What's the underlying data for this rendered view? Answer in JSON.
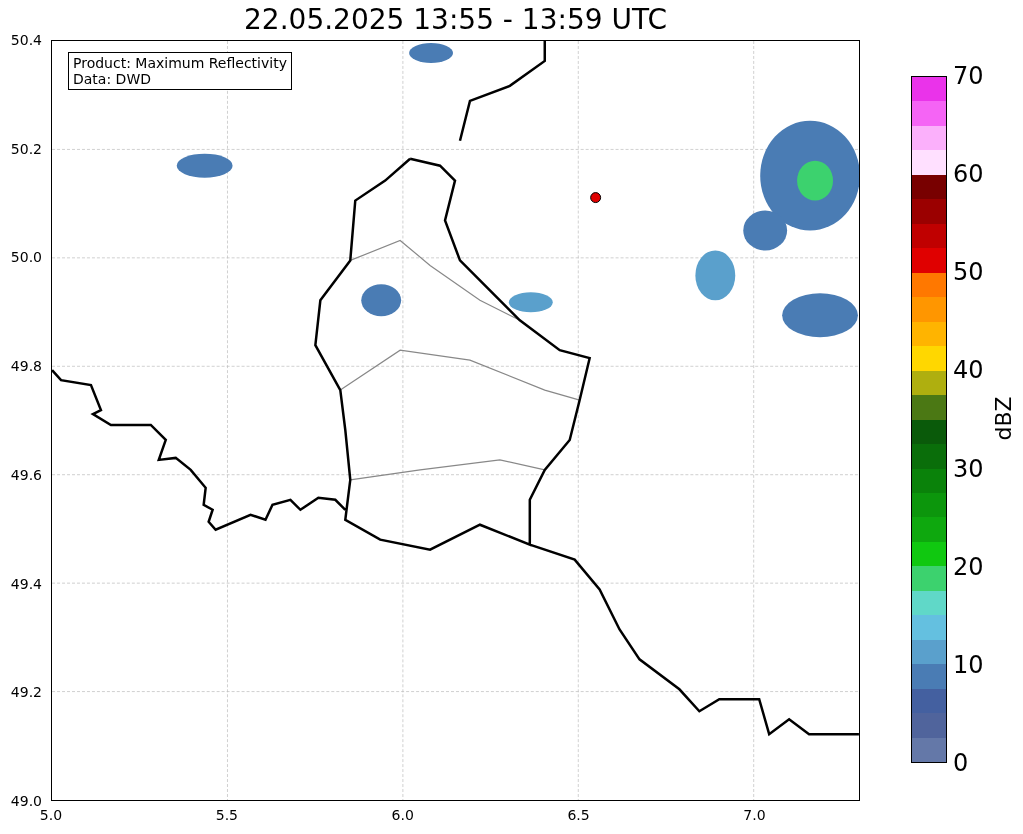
{
  "title": "22.05.2025 13:55 - 13:59 UTC",
  "map": {
    "legend": [
      "Product: Maximum Reflectivity",
      "Data: DWD"
    ],
    "x_ticks": [
      "5.0",
      "5.5",
      "6.0",
      "6.5",
      "7.0"
    ],
    "y_ticks": [
      "50.4",
      "50.2",
      "50.0",
      "49.8",
      "49.6",
      "49.4",
      "49.2",
      "49.0"
    ]
  },
  "colorbar": {
    "label": "dBZ",
    "ticks": [
      "70",
      "60",
      "50",
      "40",
      "30",
      "20",
      "10",
      "0"
    ],
    "segments": [
      {
        "color": "#ea33ea"
      },
      {
        "color": "#f564f5"
      },
      {
        "color": "#fbb0fb"
      },
      {
        "color": "#ffe0ff"
      },
      {
        "color": "#780000"
      },
      {
        "color": "#9b0000"
      },
      {
        "color": "#c00000"
      },
      {
        "color": "#e00000"
      },
      {
        "color": "#ff7800"
      },
      {
        "color": "#ff9600"
      },
      {
        "color": "#ffb400"
      },
      {
        "color": "#ffd700"
      },
      {
        "color": "#afaf0f"
      },
      {
        "color": "#4b7814"
      },
      {
        "color": "#0a5a0a"
      },
      {
        "color": "#0a6e0a"
      },
      {
        "color": "#0a820a"
      },
      {
        "color": "#0c960c"
      },
      {
        "color": "#0ea80e"
      },
      {
        "color": "#10c810"
      },
      {
        "color": "#3cd26e"
      },
      {
        "color": "#60d8c8"
      },
      {
        "color": "#64c0e0"
      },
      {
        "color": "#5aa0cc"
      },
      {
        "color": "#4a7cb4"
      },
      {
        "color": "#4460a0"
      },
      {
        "color": "#50649c"
      },
      {
        "color": "#6478a8"
      }
    ]
  }
}
